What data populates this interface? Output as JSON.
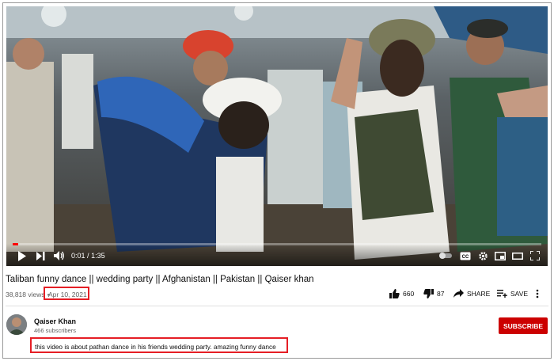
{
  "player": {
    "time_current": "0:01",
    "time_total": "1:35",
    "progress_fraction": 0.011,
    "cc_label": "CC"
  },
  "video": {
    "title": "Taliban funny dance || wedding party || Afghanistan || Pakistan || Qaiser khan",
    "views": "38,818 views",
    "separator": "•",
    "date": "Apr 10, 2021"
  },
  "actions": {
    "likes": "660",
    "dislikes": "87",
    "share_label": "SHARE",
    "save_label": "SAVE"
  },
  "channel": {
    "name": "Qaiser Khan",
    "subscribers": "466 subscribers",
    "subscribe_label": "SUBSCRIBE"
  },
  "description": {
    "text": "this video is about pathan dance in his friends wedding party. amazing funny dance"
  },
  "colors": {
    "accent_red": "#cc0000",
    "highlight_red": "#e51e25",
    "progress_red": "#ff0000"
  },
  "icons": [
    "play-icon",
    "next-icon",
    "volume-icon",
    "autoplay-toggle-icon",
    "cc-icon",
    "settings-icon",
    "miniplayer-icon",
    "theater-icon",
    "fullscreen-icon",
    "thumbs-up-icon",
    "thumbs-down-icon",
    "share-icon",
    "save-playlist-icon",
    "more-icon"
  ]
}
